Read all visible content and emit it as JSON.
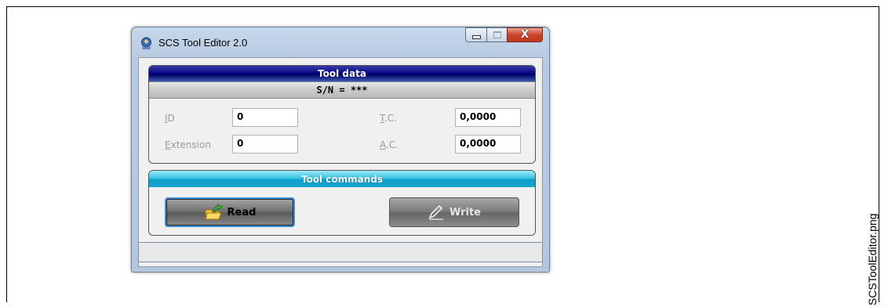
{
  "window": {
    "title": "SCS Tool Editor 2.0",
    "close_glyph": "X"
  },
  "tool_data": {
    "header": "Tool data",
    "serial": "S/N = ***",
    "fields": {
      "id": {
        "label_accel": "I",
        "label_rest": "D",
        "value": "0"
      },
      "extension": {
        "label_accel": "E",
        "label_rest": "xtension",
        "value": "0"
      },
      "tc": {
        "label_accel": "T",
        "label_rest": ".C.",
        "value": "0,0000"
      },
      "ac": {
        "label_accel": "A",
        "label_rest": ".C.",
        "value": "0,0000"
      }
    }
  },
  "tool_commands": {
    "header": "Tool commands",
    "read_label": "Read",
    "write_label": "Write"
  },
  "status_bar": {
    "text": ""
  },
  "side_caption": "SCSToolEditor.png",
  "colors": {
    "data_header": "#000064",
    "commands_header": "#1aa6d1",
    "read_focus_border": "#3c8fd6",
    "close_button": "#c9442a"
  },
  "icons": {
    "app": "globe-person-icon",
    "read": "folder-arrow-icon",
    "write": "pencil-icon"
  }
}
